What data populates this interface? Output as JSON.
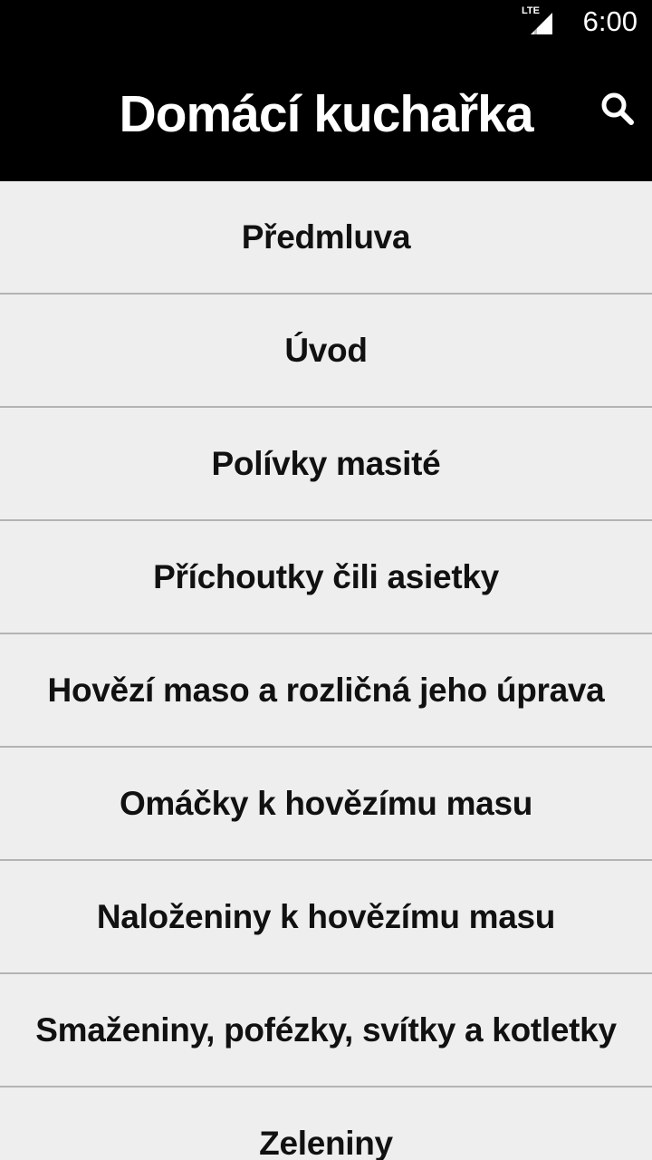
{
  "status_bar": {
    "network": "LTE",
    "time": "6:00",
    "signal_icon": "cell-signal-icon"
  },
  "app_bar": {
    "title": "Domácí kuchařka",
    "search_icon": "search-icon"
  },
  "colors": {
    "app_bar_background": "#000000",
    "list_background": "#eeeeee",
    "divider": "#b3b3b3",
    "text": "#111111"
  },
  "chapters": [
    {
      "label": "Předmluva"
    },
    {
      "label": "Úvod"
    },
    {
      "label": "Polívky masité"
    },
    {
      "label": "Příchoutky čili asietky"
    },
    {
      "label": "Hovězí maso a rozličná jeho úprava"
    },
    {
      "label": "Omáčky k hovězímu masu"
    },
    {
      "label": "Naloženiny k hovězímu masu"
    },
    {
      "label": "Smaženiny, pofézky, svítky a kotletky"
    },
    {
      "label": "Zeleniny"
    }
  ]
}
